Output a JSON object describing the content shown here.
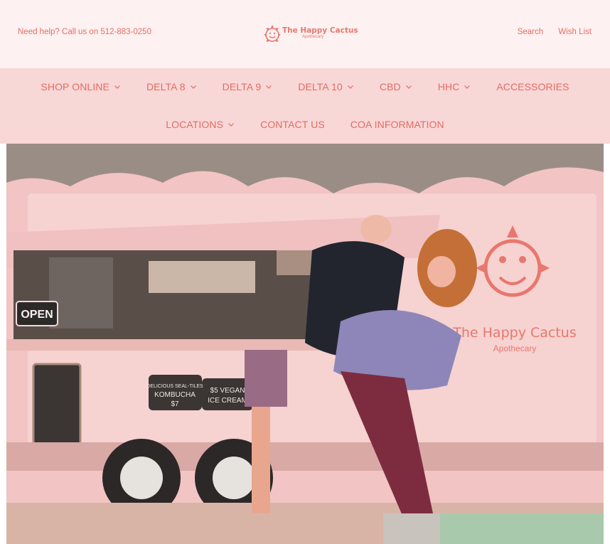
{
  "topbar": {
    "help_text": "Need help? Call us on 512-883-0250",
    "search_label": "Search",
    "wishlist_label": "Wish List"
  },
  "logo": {
    "name": "The Happy Cactus",
    "sub": "Apothecary",
    "color": "#e8776e"
  },
  "nav": {
    "row1": [
      {
        "label": "SHOP ONLINE",
        "dropdown": true
      },
      {
        "label": "DELTA 8",
        "dropdown": true
      },
      {
        "label": "DELTA 9",
        "dropdown": true
      },
      {
        "label": "DELTA 10",
        "dropdown": true
      },
      {
        "label": "CBD",
        "dropdown": true
      },
      {
        "label": "HHC",
        "dropdown": true
      },
      {
        "label": "ACCESSORIES",
        "dropdown": false
      }
    ],
    "row2": [
      {
        "label": "LOCATIONS",
        "dropdown": true
      },
      {
        "label": "CONTACT US",
        "dropdown": false
      },
      {
        "label": "COA INFORMATION",
        "dropdown": false
      }
    ]
  },
  "hero": {
    "open_sign": "OPEN",
    "trailer_brand": "The Happy Cactus",
    "trailer_brand_sub": "Apothecary",
    "sign1_line1": "DELICIOUS SEAL-TILES",
    "sign1_line2": "KOMBUCHA",
    "sign1_price": "$7",
    "sign2_line1": "$5 VEGAN",
    "sign2_line2": "ICE CREAM"
  },
  "colors": {
    "accent": "#e46c62",
    "topbar_bg": "#fdf1f1",
    "nav_bg": "#f8d7d7"
  }
}
